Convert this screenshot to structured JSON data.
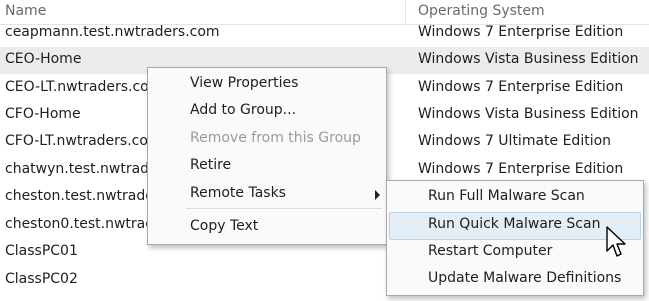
{
  "columns": {
    "name": "Name",
    "os": "Operating System"
  },
  "rows": [
    {
      "name": "ceapmann.test.nwtraders.com",
      "os": "Windows 7 Enterprise Edition"
    },
    {
      "name": "CEO-Home",
      "os": "Windows Vista Business Edition"
    },
    {
      "name": "CEO-LT.nwtraders.com",
      "os": "Windows 7 Enterprise Edition"
    },
    {
      "name": "CFO-Home",
      "os": "Windows Vista Business Edition"
    },
    {
      "name": "CFO-LT.nwtraders.com",
      "os": "Windows 7 Ultimate Edition"
    },
    {
      "name": "chatwyn.test.nwtraders.com",
      "os": "Windows 7 Enterprise Edition"
    },
    {
      "name": "cheston.test.nwtraders.com",
      "os": ""
    },
    {
      "name": "cheston0.test.nwtraders.com",
      "os": ""
    },
    {
      "name": "ClassPC01",
      "os": ""
    },
    {
      "name": "ClassPC02",
      "os": ""
    }
  ],
  "context_menu": {
    "items": [
      {
        "label": "View Properties",
        "enabled": true
      },
      {
        "label": "Add to Group...",
        "enabled": true
      },
      {
        "label": "Remove from this Group",
        "enabled": false
      },
      {
        "label": "Retire",
        "enabled": true
      },
      {
        "label": "Remote Tasks",
        "enabled": true,
        "has_submenu": true
      },
      {
        "label": "Copy Text",
        "enabled": true
      }
    ]
  },
  "remote_tasks_submenu": {
    "items": [
      {
        "label": "Run Full Malware Scan"
      },
      {
        "label": "Run Quick Malware Scan",
        "highlighted": true
      },
      {
        "label": "Restart Computer"
      },
      {
        "label": "Update Malware Definitions"
      }
    ]
  },
  "colors": {
    "selected_row": "#ececec",
    "menu_background": "#fafafa",
    "highlight_fill": "#e3eef7",
    "highlight_border": "#b9d3ea",
    "disabled_text": "#9a9a9a"
  }
}
